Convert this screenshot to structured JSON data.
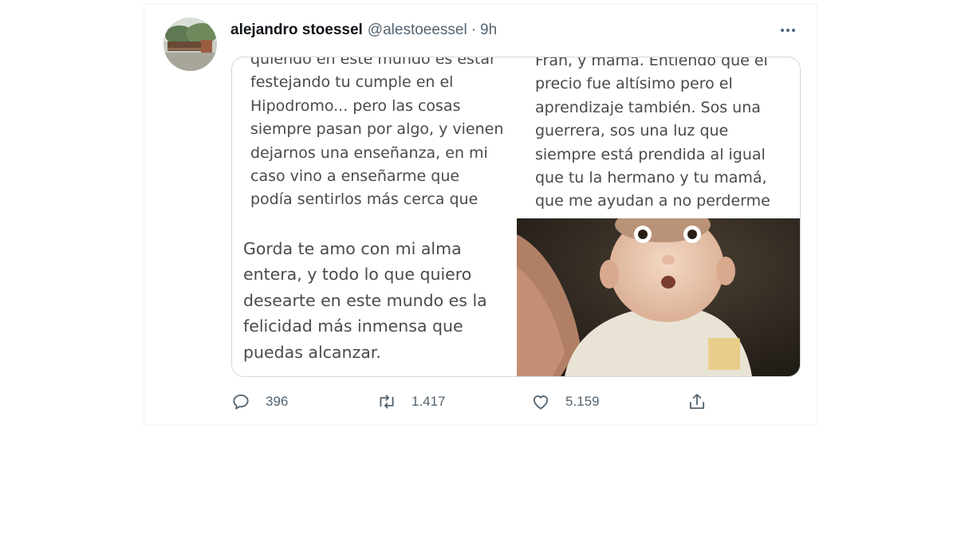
{
  "tweet": {
    "display_name": "alejandro stoessel",
    "handle": "@alestoeessel",
    "separator": "·",
    "time": "9h",
    "more_icon": "more-horizontal-icon"
  },
  "media": {
    "panel_1_text": "quiendo en este mundo es estar\nfestejando tu cumple en el\nHipodromo... pero las cosas\nsiempre pasan por algo, y vienen\ndejarnos una enseñanza, en mi\ncaso vino a enseñarme que\npodía sentirlos más cerca que",
    "panel_2_text": "Fran, y mamá. Entiendo que el\nprecio fue altísimo pero el\naprendizaje también. Sos una\nguerrera, sos una luz que\nsiempre está prendida al igual\nque tu la hermano y tu mamá,\nque me ayudan a no perderme",
    "panel_3_text": "Gorda te amo con mi alma\nentera, y todo lo que quiero\ndesearte en este mundo es la\nfelicidad más inmensa que\npuedas alcanzar.",
    "panel_4_photo": "baby-photo"
  },
  "actions": {
    "reply_count": "396",
    "retweet_count": "1.417",
    "like_count": "5.159"
  },
  "colors": {
    "text_primary": "#0f1419",
    "text_secondary": "#536471",
    "border": "#cfd9de"
  }
}
